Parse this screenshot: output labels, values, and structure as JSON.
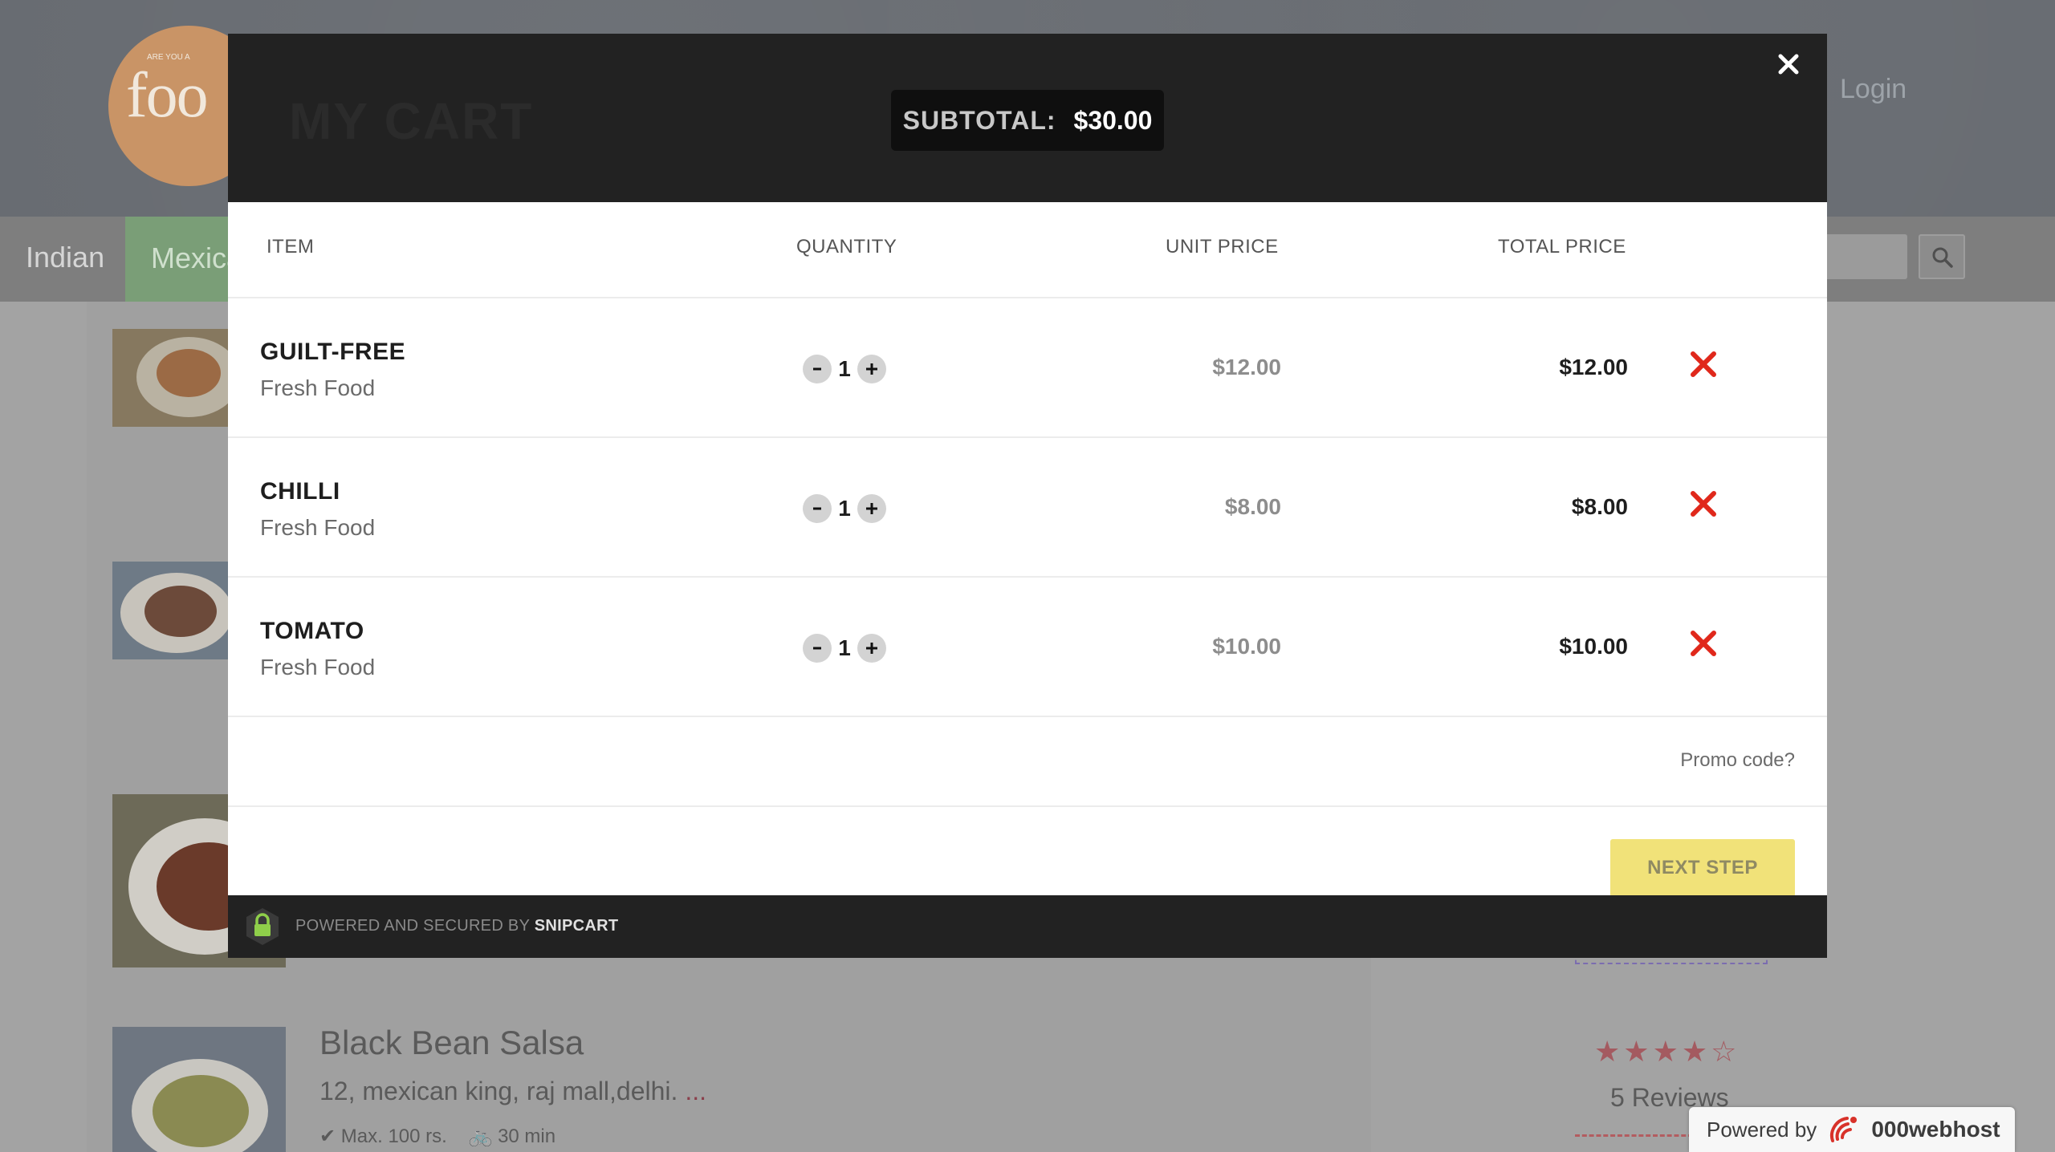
{
  "background": {
    "logo_text": "foo",
    "logo_small": "ARE YOU A",
    "login": "Login",
    "nav": [
      "Indian",
      "Mexica"
    ],
    "restaurant": {
      "title": "Black Bean Salsa",
      "address": "12, mexican king, raj mall,delhi.",
      "address_more": "...",
      "max_price": "Max. 100 rs.",
      "delivery_time": "30 min",
      "rating_stars": 4,
      "reviews": "5 Reviews"
    }
  },
  "cart": {
    "title": "MY CART",
    "subtotal_label": "SUBTOTAL:",
    "subtotal_value": "$30.00",
    "columns": {
      "item": "ITEM",
      "quantity": "QUANTITY",
      "unit_price": "UNIT PRICE",
      "total_price": "TOTAL PRICE"
    },
    "items": [
      {
        "name": "GUILT-FREE",
        "desc": "Fresh Food",
        "qty": "1",
        "unit": "$12.00",
        "total": "$12.00"
      },
      {
        "name": "CHILLI",
        "desc": "Fresh Food",
        "qty": "1",
        "unit": "$8.00",
        "total": "$8.00"
      },
      {
        "name": "TOMATO",
        "desc": "Fresh Food",
        "qty": "1",
        "unit": "$10.00",
        "total": "$10.00"
      }
    ],
    "promo": "Promo code?",
    "next_step": "NEXT STEP",
    "footer_text": "POWERED AND SECURED BY",
    "footer_brand": "SNIPCART"
  },
  "badge": {
    "powered_by": "Powered by",
    "brand": "000webhost"
  },
  "colors": {
    "remove": "#e0281b",
    "next_step_bg": "#f1e279",
    "lock": "#8fcf4a"
  }
}
